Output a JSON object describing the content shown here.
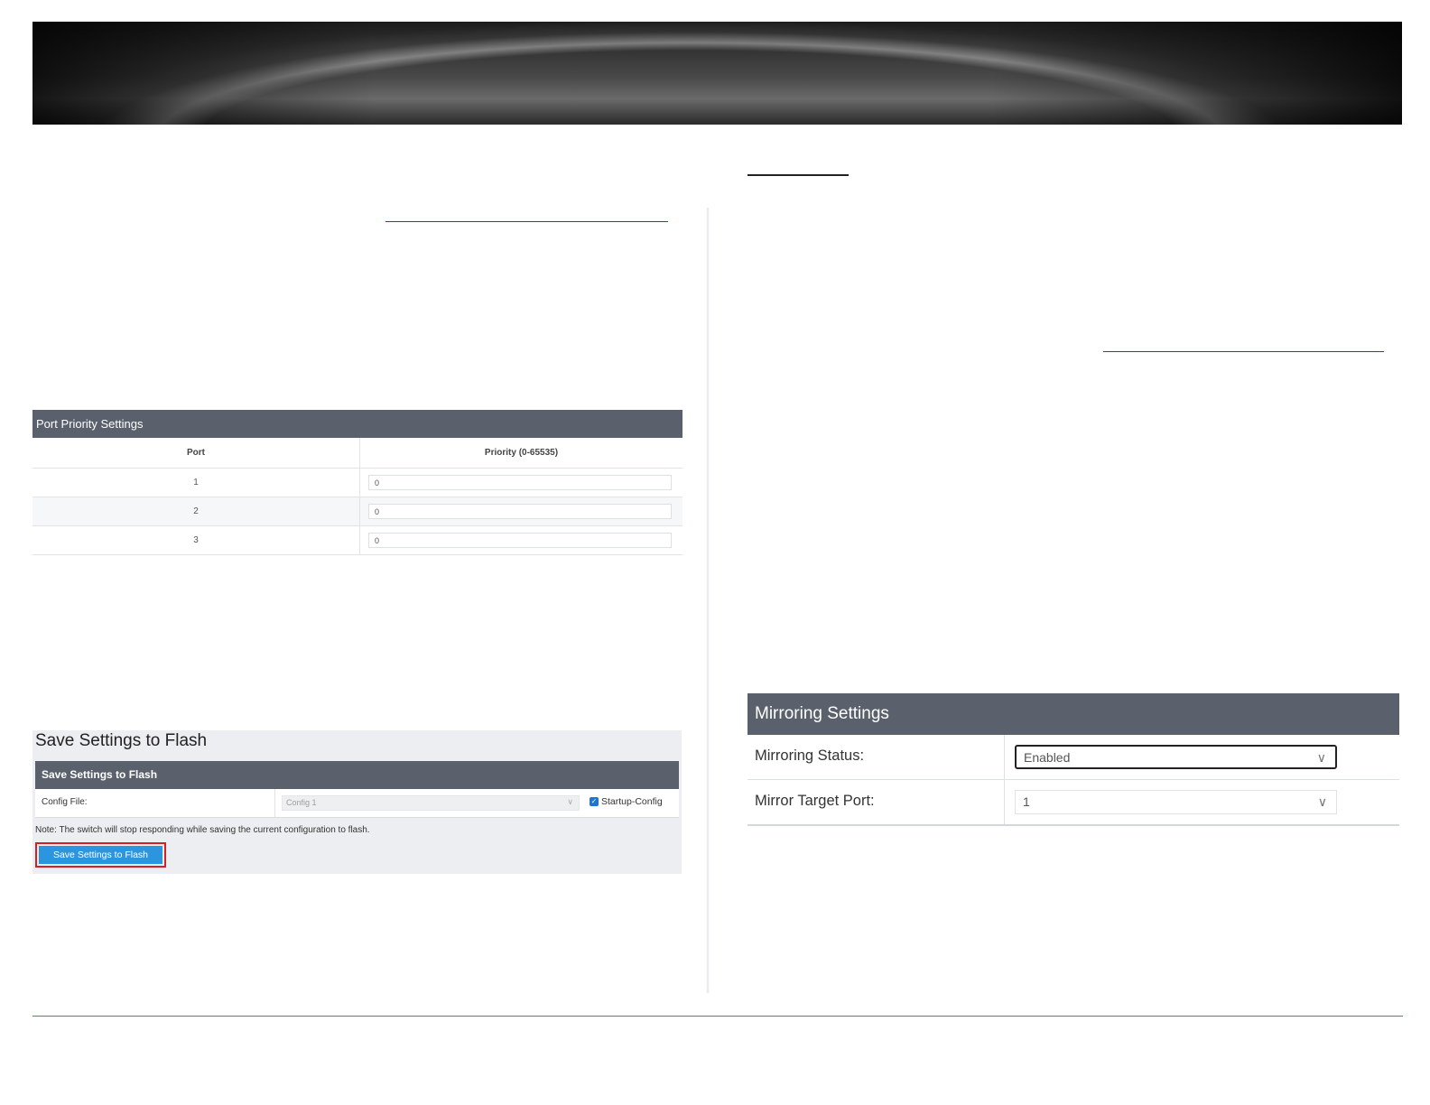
{
  "port_priority": {
    "title": "Port Priority Settings",
    "col_port": "Port",
    "col_priority": "Priority (0-65535)",
    "rows": [
      {
        "port": "1",
        "priority": "0"
      },
      {
        "port": "2",
        "priority": "0"
      },
      {
        "port": "3",
        "priority": "0"
      }
    ]
  },
  "save_flash": {
    "page_title": "Save Settings to Flash",
    "section_title": "Save Settings to Flash",
    "config_label": "Config File:",
    "config_value": "Config 1",
    "checkbox_label": "Startup-Config",
    "checkbox_checked": true,
    "note": "Note: The switch will stop responding while saving the current configuration to flash.",
    "button_label": "Save Settings to Flash",
    "button_color": "#2c95e0",
    "highlight_color": "#d32027"
  },
  "mirroring": {
    "title": "Mirroring Settings",
    "status_label": "Mirroring Status:",
    "status_value": "Enabled",
    "target_label": "Mirror Target Port:",
    "target_value": "1"
  },
  "colors": {
    "panel_header": "#5a616c",
    "link_rule": "#1a3fd0",
    "footer_rule": "#3d7fc9"
  }
}
